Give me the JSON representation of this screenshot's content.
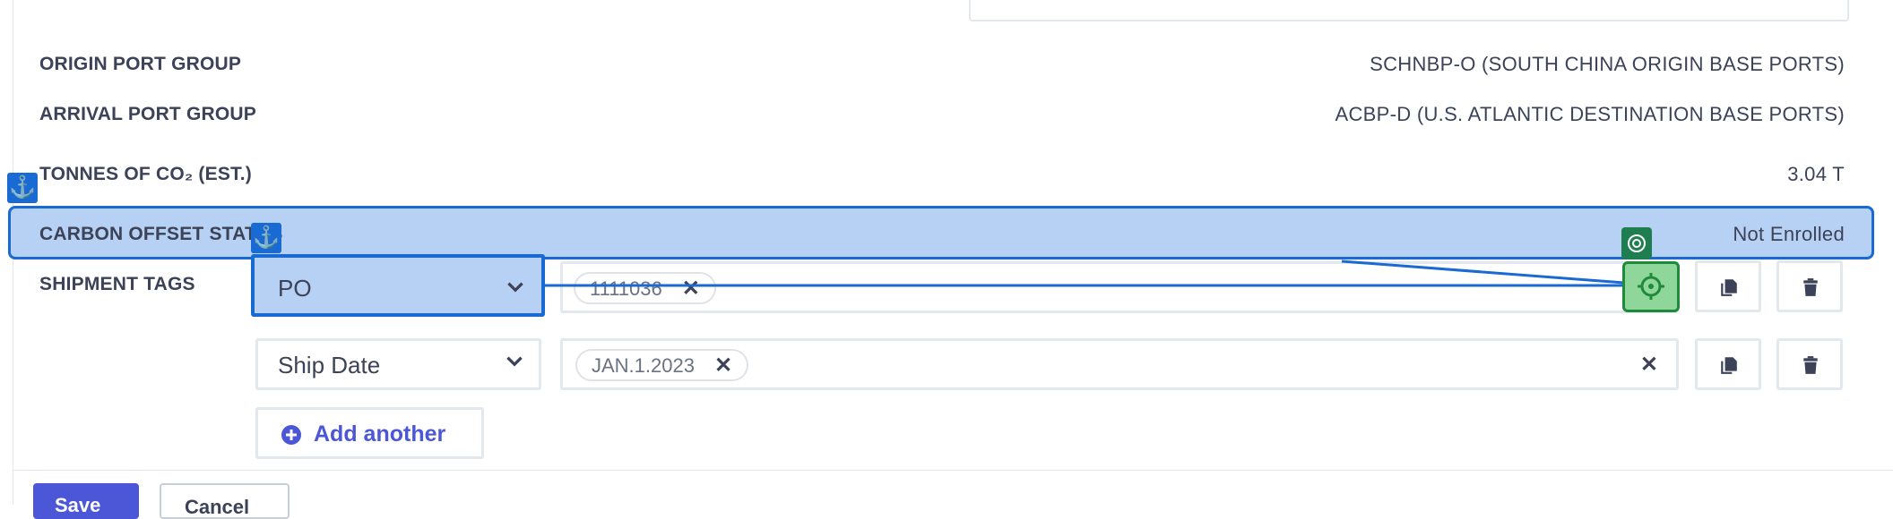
{
  "details": [
    {
      "label": "ORIGIN PORT GROUP",
      "value": "SCHNBP-O (SOUTH CHINA ORIGIN BASE PORTS)"
    },
    {
      "label": "ARRIVAL PORT GROUP",
      "value": "ACBP-D (U.S. ATLANTIC DESTINATION BASE PORTS)"
    },
    {
      "label": "TONNES OF CO₂ (EST.)",
      "value": "3.04 T"
    },
    {
      "label": "CARBON OFFSET STATUS",
      "value": "Not Enrolled"
    }
  ],
  "shipment_tags": {
    "label": "SHIPMENT TAGS",
    "rows": [
      {
        "type": "PO",
        "tag": "1111036"
      },
      {
        "type": "Ship Date",
        "tag": "JAN.1.2023"
      }
    ],
    "add_label": "Add another"
  },
  "footer": {
    "save_label": "Save",
    "cancel_label": "Cancel"
  },
  "colors": {
    "accent": "#4b57d6",
    "highlight": "#1a6ad4",
    "target": "#1e8a3a"
  },
  "icons": [
    "anchor-icon",
    "chevron-down-icon",
    "close-icon",
    "copy-icon",
    "trash-icon",
    "target-icon",
    "plus-circle-icon"
  ]
}
